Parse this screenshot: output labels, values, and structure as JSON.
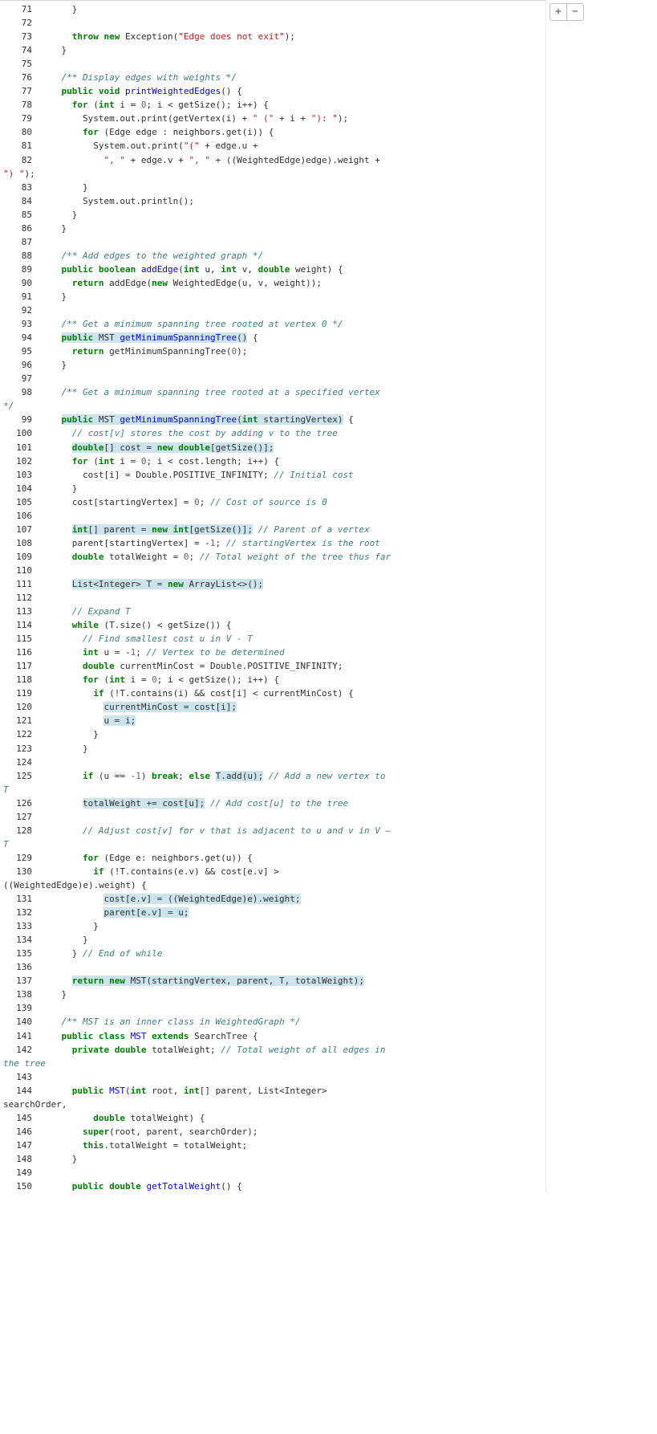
{
  "toolbar": {
    "plus": "+",
    "minus": "−"
  },
  "lines": [
    {
      "n": 71,
      "segs": [
        {
          "t": "      }"
        }
      ]
    },
    {
      "n": 72,
      "segs": []
    },
    {
      "n": 73,
      "segs": [
        {
          "t": "      "
        },
        {
          "t": "throw",
          "c": "kw"
        },
        {
          "t": " "
        },
        {
          "t": "new",
          "c": "kw"
        },
        {
          "t": " Exception("
        },
        {
          "t": "\"Edge does not exit\"",
          "c": "st"
        },
        {
          "t": ");"
        }
      ]
    },
    {
      "n": 74,
      "segs": [
        {
          "t": "    }"
        }
      ]
    },
    {
      "n": 75,
      "segs": []
    },
    {
      "n": 76,
      "segs": [
        {
          "t": "    "
        },
        {
          "t": "/** Display edges with weights */",
          "c": "jd"
        }
      ]
    },
    {
      "n": 77,
      "segs": [
        {
          "t": "    "
        },
        {
          "t": "public",
          "c": "kw"
        },
        {
          "t": " "
        },
        {
          "t": "void",
          "c": "kw"
        },
        {
          "t": " "
        },
        {
          "t": "printWeightedEdges",
          "c": "fn"
        },
        {
          "t": "() {"
        }
      ]
    },
    {
      "n": 78,
      "segs": [
        {
          "t": "      "
        },
        {
          "t": "for",
          "c": "kw"
        },
        {
          "t": " ("
        },
        {
          "t": "int",
          "c": "kw"
        },
        {
          "t": " i = "
        },
        {
          "t": "0",
          "c": "nm"
        },
        {
          "t": "; i < getSize(); i++) {"
        }
      ]
    },
    {
      "n": 79,
      "segs": [
        {
          "t": "        System.out.print(getVertex(i) + "
        },
        {
          "t": "\" (\"",
          "c": "st"
        },
        {
          "t": " + i + "
        },
        {
          "t": "\"): \"",
          "c": "st"
        },
        {
          "t": ");"
        }
      ]
    },
    {
      "n": 80,
      "segs": [
        {
          "t": "        "
        },
        {
          "t": "for",
          "c": "kw"
        },
        {
          "t": " (Edge edge : neighbors.get(i)) {"
        }
      ]
    },
    {
      "n": 81,
      "segs": [
        {
          "t": "          System.out.print("
        },
        {
          "t": "\"(\"",
          "c": "st"
        },
        {
          "t": " + edge.u +"
        }
      ]
    },
    {
      "n": 82,
      "segs": [
        {
          "t": "            "
        },
        {
          "t": "\", \"",
          "c": "st"
        },
        {
          "t": " + edge.v + "
        },
        {
          "t": "\", \"",
          "c": "st"
        },
        {
          "t": " + ((WeightedEdge)edge).weight + "
        }
      ],
      "wrap": [
        {
          "t": "\") \"",
          "c": "st"
        },
        {
          "t": ");"
        }
      ]
    },
    {
      "n": 83,
      "segs": [
        {
          "t": "        }"
        }
      ]
    },
    {
      "n": 84,
      "segs": [
        {
          "t": "        System.out.println();"
        }
      ]
    },
    {
      "n": 85,
      "segs": [
        {
          "t": "      }"
        }
      ]
    },
    {
      "n": 86,
      "segs": [
        {
          "t": "    }"
        }
      ]
    },
    {
      "n": 87,
      "segs": []
    },
    {
      "n": 88,
      "segs": [
        {
          "t": "    "
        },
        {
          "t": "/** Add edges to the weighted graph */",
          "c": "jd"
        }
      ]
    },
    {
      "n": 89,
      "segs": [
        {
          "t": "    "
        },
        {
          "t": "public",
          "c": "kw"
        },
        {
          "t": " "
        },
        {
          "t": "boolean",
          "c": "kw"
        },
        {
          "t": " "
        },
        {
          "t": "addEdge",
          "c": "fn"
        },
        {
          "t": "("
        },
        {
          "t": "int",
          "c": "kw"
        },
        {
          "t": " u, "
        },
        {
          "t": "int",
          "c": "kw"
        },
        {
          "t": " v, "
        },
        {
          "t": "double",
          "c": "kw"
        },
        {
          "t": " weight) {"
        }
      ]
    },
    {
      "n": 90,
      "segs": [
        {
          "t": "      "
        },
        {
          "t": "return",
          "c": "kw"
        },
        {
          "t": " addEdge("
        },
        {
          "t": "new",
          "c": "kw"
        },
        {
          "t": " WeightedEdge(u, v, weight));"
        }
      ]
    },
    {
      "n": 91,
      "segs": [
        {
          "t": "    }"
        }
      ]
    },
    {
      "n": 92,
      "segs": []
    },
    {
      "n": 93,
      "segs": [
        {
          "t": "    "
        },
        {
          "t": "/** Get a minimum spanning tree rooted at vertex 0 */",
          "c": "jd"
        }
      ]
    },
    {
      "n": 94,
      "segs": [
        {
          "t": "    "
        },
        {
          "t": "public",
          "c": "kw",
          "h": true
        },
        {
          "t": " MST ",
          "h": true
        },
        {
          "t": "getMinimumSpanningTree",
          "c": "fn",
          "h": true
        },
        {
          "t": "()",
          "h": true
        },
        {
          "t": " {"
        }
      ]
    },
    {
      "n": 95,
      "segs": [
        {
          "t": "      "
        },
        {
          "t": "return",
          "c": "kw"
        },
        {
          "t": " getMinimumSpanningTree("
        },
        {
          "t": "0",
          "c": "nm"
        },
        {
          "t": ");"
        }
      ]
    },
    {
      "n": 96,
      "segs": [
        {
          "t": "    }"
        }
      ]
    },
    {
      "n": 97,
      "segs": []
    },
    {
      "n": 98,
      "segs": [
        {
          "t": "    "
        },
        {
          "t": "/** Get a minimum spanning tree rooted at a specified vertex ",
          "c": "jd"
        }
      ],
      "wrap": [
        {
          "t": "*/",
          "c": "jd"
        }
      ]
    },
    {
      "n": 99,
      "segs": [
        {
          "t": "    "
        },
        {
          "t": "public",
          "c": "kw",
          "h": true
        },
        {
          "t": " MST ",
          "h": true
        },
        {
          "t": "getMinimumSpanningTree",
          "c": "fn",
          "h": true
        },
        {
          "t": "(",
          "h": true
        },
        {
          "t": "int",
          "c": "kw",
          "h": true
        },
        {
          "t": " startingVertex)",
          "h": true
        },
        {
          "t": " {"
        }
      ]
    },
    {
      "n": 100,
      "segs": [
        {
          "t": "      "
        },
        {
          "t": "// cost[v] stores the cost by adding v to the tree",
          "c": "cm"
        }
      ]
    },
    {
      "n": 101,
      "segs": [
        {
          "t": "      "
        },
        {
          "t": "double",
          "c": "kw",
          "h": true
        },
        {
          "t": "[] cost = ",
          "h": true
        },
        {
          "t": "new",
          "c": "kw",
          "h": true
        },
        {
          "t": " ",
          "h": true
        },
        {
          "t": "double",
          "c": "kw",
          "h": true
        },
        {
          "t": "[getSize()];",
          "h": true
        }
      ]
    },
    {
      "n": 102,
      "segs": [
        {
          "t": "      "
        },
        {
          "t": "for",
          "c": "kw"
        },
        {
          "t": " ("
        },
        {
          "t": "int",
          "c": "kw"
        },
        {
          "t": " i = "
        },
        {
          "t": "0",
          "c": "nm"
        },
        {
          "t": "; i < cost.length; i++) {"
        }
      ]
    },
    {
      "n": 103,
      "segs": [
        {
          "t": "        cost[i] = Double.POSITIVE_INFINITY; "
        },
        {
          "t": "// Initial cost",
          "c": "cm"
        }
      ]
    },
    {
      "n": 104,
      "segs": [
        {
          "t": "      }"
        }
      ]
    },
    {
      "n": 105,
      "segs": [
        {
          "t": "      cost[startingVertex] = "
        },
        {
          "t": "0",
          "c": "nm"
        },
        {
          "t": "; "
        },
        {
          "t": "// Cost of source is 0",
          "c": "cm"
        }
      ]
    },
    {
      "n": 106,
      "segs": []
    },
    {
      "n": 107,
      "segs": [
        {
          "t": "      "
        },
        {
          "t": "int",
          "c": "kw",
          "h": true
        },
        {
          "t": "[] parent = ",
          "h": true
        },
        {
          "t": "new",
          "c": "kw",
          "h": true
        },
        {
          "t": " ",
          "h": true
        },
        {
          "t": "int",
          "c": "kw",
          "h": true
        },
        {
          "t": "[getSize()];",
          "h": true
        },
        {
          "t": " "
        },
        {
          "t": "// Parent of a vertex",
          "c": "cm"
        }
      ]
    },
    {
      "n": 108,
      "segs": [
        {
          "t": "      parent[startingVertex] = -"
        },
        {
          "t": "1",
          "c": "nm"
        },
        {
          "t": "; "
        },
        {
          "t": "// startingVertex is the root",
          "c": "cm"
        }
      ]
    },
    {
      "n": 109,
      "segs": [
        {
          "t": "      "
        },
        {
          "t": "double",
          "c": "kw"
        },
        {
          "t": " totalWeight = "
        },
        {
          "t": "0",
          "c": "nm"
        },
        {
          "t": "; "
        },
        {
          "t": "// Total weight of the tree thus far",
          "c": "cm"
        }
      ]
    },
    {
      "n": 110,
      "segs": []
    },
    {
      "n": 111,
      "segs": [
        {
          "t": "      "
        },
        {
          "t": "List<Integer> T = ",
          "h": true
        },
        {
          "t": "new",
          "c": "kw",
          "h": true
        },
        {
          "t": " ArrayList<>();",
          "h": true
        }
      ]
    },
    {
      "n": 112,
      "segs": []
    },
    {
      "n": 113,
      "segs": [
        {
          "t": "      "
        },
        {
          "t": "// Expand T",
          "c": "cm"
        }
      ]
    },
    {
      "n": 114,
      "segs": [
        {
          "t": "      "
        },
        {
          "t": "while",
          "c": "kw"
        },
        {
          "t": " (T.size() < getSize()) {"
        }
      ]
    },
    {
      "n": 115,
      "segs": [
        {
          "t": "        "
        },
        {
          "t": "// Find smallest cost u in V - T",
          "c": "cm"
        }
      ]
    },
    {
      "n": 116,
      "segs": [
        {
          "t": "        "
        },
        {
          "t": "int",
          "c": "kw"
        },
        {
          "t": " u = -"
        },
        {
          "t": "1",
          "c": "nm"
        },
        {
          "t": "; "
        },
        {
          "t": "// Vertex to be determined",
          "c": "cm"
        }
      ]
    },
    {
      "n": 117,
      "segs": [
        {
          "t": "        "
        },
        {
          "t": "double",
          "c": "kw"
        },
        {
          "t": " currentMinCost = Double.POSITIVE_INFINITY;"
        }
      ]
    },
    {
      "n": 118,
      "segs": [
        {
          "t": "        "
        },
        {
          "t": "for",
          "c": "kw"
        },
        {
          "t": " ("
        },
        {
          "t": "int",
          "c": "kw"
        },
        {
          "t": " i = "
        },
        {
          "t": "0",
          "c": "nm"
        },
        {
          "t": "; i < getSize(); i++) {"
        }
      ]
    },
    {
      "n": 119,
      "segs": [
        {
          "t": "          "
        },
        {
          "t": "if",
          "c": "kw"
        },
        {
          "t": " (!T.contains(i) && cost[i] < currentMinCost) {"
        }
      ]
    },
    {
      "n": 120,
      "segs": [
        {
          "t": "            "
        },
        {
          "t": "currentMinCost = cost[i];",
          "h": true
        }
      ]
    },
    {
      "n": 121,
      "segs": [
        {
          "t": "            "
        },
        {
          "t": "u = i;",
          "h": true
        }
      ]
    },
    {
      "n": 122,
      "segs": [
        {
          "t": "          }"
        }
      ]
    },
    {
      "n": 123,
      "segs": [
        {
          "t": "        }"
        }
      ]
    },
    {
      "n": 124,
      "segs": []
    },
    {
      "n": 125,
      "segs": [
        {
          "t": "        "
        },
        {
          "t": "if",
          "c": "kw"
        },
        {
          "t": " (u == -"
        },
        {
          "t": "1",
          "c": "nm"
        },
        {
          "t": ") "
        },
        {
          "t": "break",
          "c": "kw"
        },
        {
          "t": "; "
        },
        {
          "t": "else",
          "c": "kw"
        },
        {
          "t": " "
        },
        {
          "t": "T.add(u);",
          "h": true
        },
        {
          "t": " "
        },
        {
          "t": "// Add a new vertex to ",
          "c": "cm"
        }
      ],
      "wrap": [
        {
          "t": "T",
          "c": "cm"
        }
      ]
    },
    {
      "n": 126,
      "segs": [
        {
          "t": "        "
        },
        {
          "t": "totalWeight += cost[u];",
          "h": true
        },
        {
          "t": " "
        },
        {
          "t": "// Add cost[u] to the tree",
          "c": "cm"
        }
      ]
    },
    {
      "n": 127,
      "segs": []
    },
    {
      "n": 128,
      "segs": [
        {
          "t": "        "
        },
        {
          "t": "// Adjust cost[v] for v that is adjacent to u and v in V – ",
          "c": "cm"
        }
      ],
      "wrap": [
        {
          "t": "T",
          "c": "cm"
        }
      ]
    },
    {
      "n": 129,
      "segs": [
        {
          "t": "        "
        },
        {
          "t": "for",
          "c": "kw"
        },
        {
          "t": " (Edge e: neighbors.get(u)) {"
        }
      ]
    },
    {
      "n": 130,
      "segs": [
        {
          "t": "          "
        },
        {
          "t": "if",
          "c": "kw"
        },
        {
          "t": " (!T.contains(e.v) && cost[e.v] > "
        }
      ],
      "wrap": [
        {
          "t": "((WeightedEdge)e).weight) {"
        }
      ]
    },
    {
      "n": 131,
      "segs": [
        {
          "t": "            "
        },
        {
          "t": "cost[e.v] = ((WeightedEdge)e).weight;",
          "h": true
        }
      ]
    },
    {
      "n": 132,
      "segs": [
        {
          "t": "            "
        },
        {
          "t": "parent[e.v] = u;",
          "h": true
        }
      ]
    },
    {
      "n": 133,
      "segs": [
        {
          "t": "          }"
        }
      ]
    },
    {
      "n": 134,
      "segs": [
        {
          "t": "        }"
        }
      ]
    },
    {
      "n": 135,
      "segs": [
        {
          "t": "      } "
        },
        {
          "t": "// End of while",
          "c": "cm"
        }
      ]
    },
    {
      "n": 136,
      "segs": []
    },
    {
      "n": 137,
      "segs": [
        {
          "t": "      "
        },
        {
          "t": "return",
          "c": "kw",
          "h": true
        },
        {
          "t": " ",
          "h": true
        },
        {
          "t": "new",
          "c": "kw",
          "h": true
        },
        {
          "t": " MST(startingVertex, parent, T, totalWeight);",
          "h": true
        }
      ]
    },
    {
      "n": 138,
      "segs": [
        {
          "t": "    }"
        }
      ]
    },
    {
      "n": 139,
      "segs": []
    },
    {
      "n": 140,
      "segs": [
        {
          "t": "    "
        },
        {
          "t": "/** MST is an inner class in WeightedGraph */",
          "c": "jd"
        }
      ]
    },
    {
      "n": 141,
      "segs": [
        {
          "t": "    "
        },
        {
          "t": "public",
          "c": "kw"
        },
        {
          "t": " "
        },
        {
          "t": "class",
          "c": "kw"
        },
        {
          "t": " "
        },
        {
          "t": "MST",
          "c": "fn"
        },
        {
          "t": " "
        },
        {
          "t": "extends",
          "c": "kw"
        },
        {
          "t": " SearchTree {"
        }
      ]
    },
    {
      "n": 142,
      "segs": [
        {
          "t": "      "
        },
        {
          "t": "private",
          "c": "kw"
        },
        {
          "t": " "
        },
        {
          "t": "double",
          "c": "kw"
        },
        {
          "t": " totalWeight; "
        },
        {
          "t": "// Total weight of all edges in ",
          "c": "cm"
        }
      ],
      "wrap": [
        {
          "t": "the tree",
          "c": "cm"
        }
      ]
    },
    {
      "n": 143,
      "segs": []
    },
    {
      "n": 144,
      "segs": [
        {
          "t": "      "
        },
        {
          "t": "public",
          "c": "kw"
        },
        {
          "t": " "
        },
        {
          "t": "MST",
          "c": "fn"
        },
        {
          "t": "("
        },
        {
          "t": "int",
          "c": "kw"
        },
        {
          "t": " root, "
        },
        {
          "t": "int",
          "c": "kw"
        },
        {
          "t": "[] parent, List<Integer> "
        }
      ],
      "wrap": [
        {
          "t": "searchOrder,"
        }
      ]
    },
    {
      "n": 145,
      "segs": [
        {
          "t": "          "
        },
        {
          "t": "double",
          "c": "kw"
        },
        {
          "t": " totalWeight) {"
        }
      ]
    },
    {
      "n": 146,
      "segs": [
        {
          "t": "        "
        },
        {
          "t": "super",
          "c": "kw"
        },
        {
          "t": "(root, parent, searchOrder);"
        }
      ]
    },
    {
      "n": 147,
      "segs": [
        {
          "t": "        "
        },
        {
          "t": "this",
          "c": "kw"
        },
        {
          "t": ".totalWeight = totalWeight;"
        }
      ]
    },
    {
      "n": 148,
      "segs": [
        {
          "t": "      }"
        }
      ]
    },
    {
      "n": 149,
      "segs": []
    },
    {
      "n": 150,
      "segs": [
        {
          "t": "      "
        },
        {
          "t": "public",
          "c": "kw"
        },
        {
          "t": " "
        },
        {
          "t": "double",
          "c": "kw"
        },
        {
          "t": " "
        },
        {
          "t": "getTotalWeight",
          "c": "fn"
        },
        {
          "t": "() {"
        }
      ]
    }
  ]
}
